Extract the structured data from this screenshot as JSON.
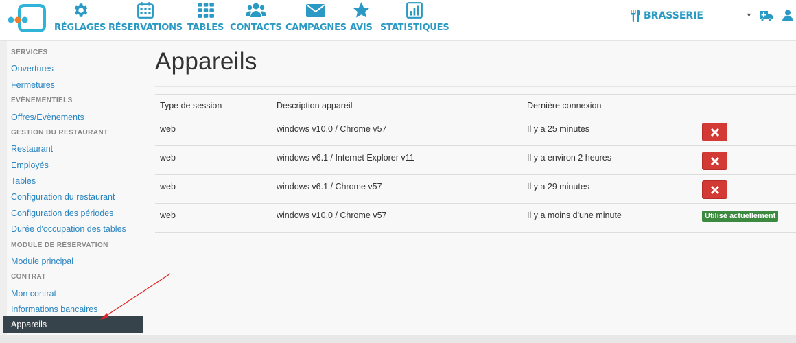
{
  "nav": {
    "items": [
      {
        "label": "RÉGLAGES",
        "icon": "gear-icon"
      },
      {
        "label": "RÉSERVATIONS",
        "icon": "calendar-icon"
      },
      {
        "label": "TABLES",
        "icon": "grid-icon"
      },
      {
        "label": "CONTACTS",
        "icon": "users-icon"
      },
      {
        "label": "CAMPAGNES",
        "icon": "envelope-icon"
      },
      {
        "label": "AVIS",
        "icon": "star-icon"
      },
      {
        "label": "STATISTIQUES",
        "icon": "chart-icon"
      }
    ],
    "restaurant": "BRASSERIE",
    "accent_color": "#2a9ac4"
  },
  "sidebar": {
    "sections": [
      {
        "heading": "SERVICES",
        "links": [
          "Ouvertures",
          "Fermetures"
        ]
      },
      {
        "heading": "EVÈNEMENTIELS",
        "links": [
          "Offres/Evènements"
        ]
      },
      {
        "heading": "GESTION DU RESTAURANT",
        "links": [
          "Restaurant",
          "Employés",
          "Tables",
          "Configuration du restaurant",
          "Configuration des périodes",
          "Durée d'occupation des tables"
        ]
      },
      {
        "heading": "MODULE DE RÉSERVATION",
        "links": [
          "Module principal"
        ]
      },
      {
        "heading": "CONTRAT",
        "links": [
          "Mon contrat",
          "Informations bancaires"
        ]
      }
    ],
    "active": "Appareils"
  },
  "main": {
    "title": "Appareils",
    "table": {
      "headers": [
        "Type de session",
        "Description appareil",
        "Dernière connexion",
        ""
      ],
      "rows": [
        {
          "session": "web",
          "device": "windows v10.0 / Chrome v57",
          "last": "Il y a 25 minutes",
          "current": false
        },
        {
          "session": "web",
          "device": "windows v6.1 / Internet Explorer v11",
          "last": "Il y a environ 2 heures",
          "current": false
        },
        {
          "session": "web",
          "device": "windows v6.1 / Chrome v57",
          "last": "Il y a 29 minutes",
          "current": false
        },
        {
          "session": "web",
          "device": "windows v10.0 / Chrome v57",
          "last": "Il y a moins d'une minute",
          "current": true
        }
      ],
      "current_badge": "Utilisé actuellement"
    }
  }
}
